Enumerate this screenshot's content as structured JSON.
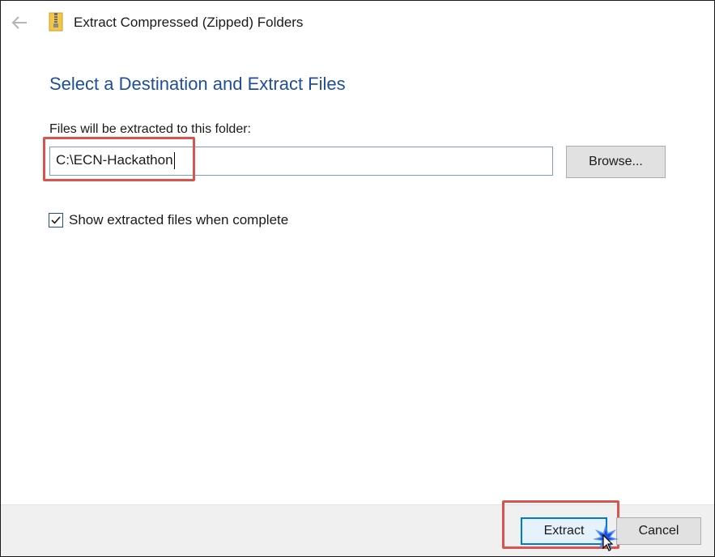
{
  "window": {
    "title": "Extract Compressed (Zipped) Folders"
  },
  "icons": {
    "back": "back-arrow-icon",
    "zip": "zip-folder-icon",
    "checkmark": "checkmark-icon",
    "cursor": "mouse-cursor-icon"
  },
  "colors": {
    "heading": "#1f4e9c",
    "highlight": "#d9534f",
    "accent": "#0078d7"
  },
  "content": {
    "heading": "Select a Destination and Extract Files",
    "destination_label": "Files will be extracted to this folder:",
    "destination_value": "C:\\ECN-Hackathon",
    "browse_label": "Browse...",
    "show_files_label": "Show extracted files when complete",
    "show_files_checked": true
  },
  "footer": {
    "extract_label": "Extract",
    "cancel_label": "Cancel"
  }
}
